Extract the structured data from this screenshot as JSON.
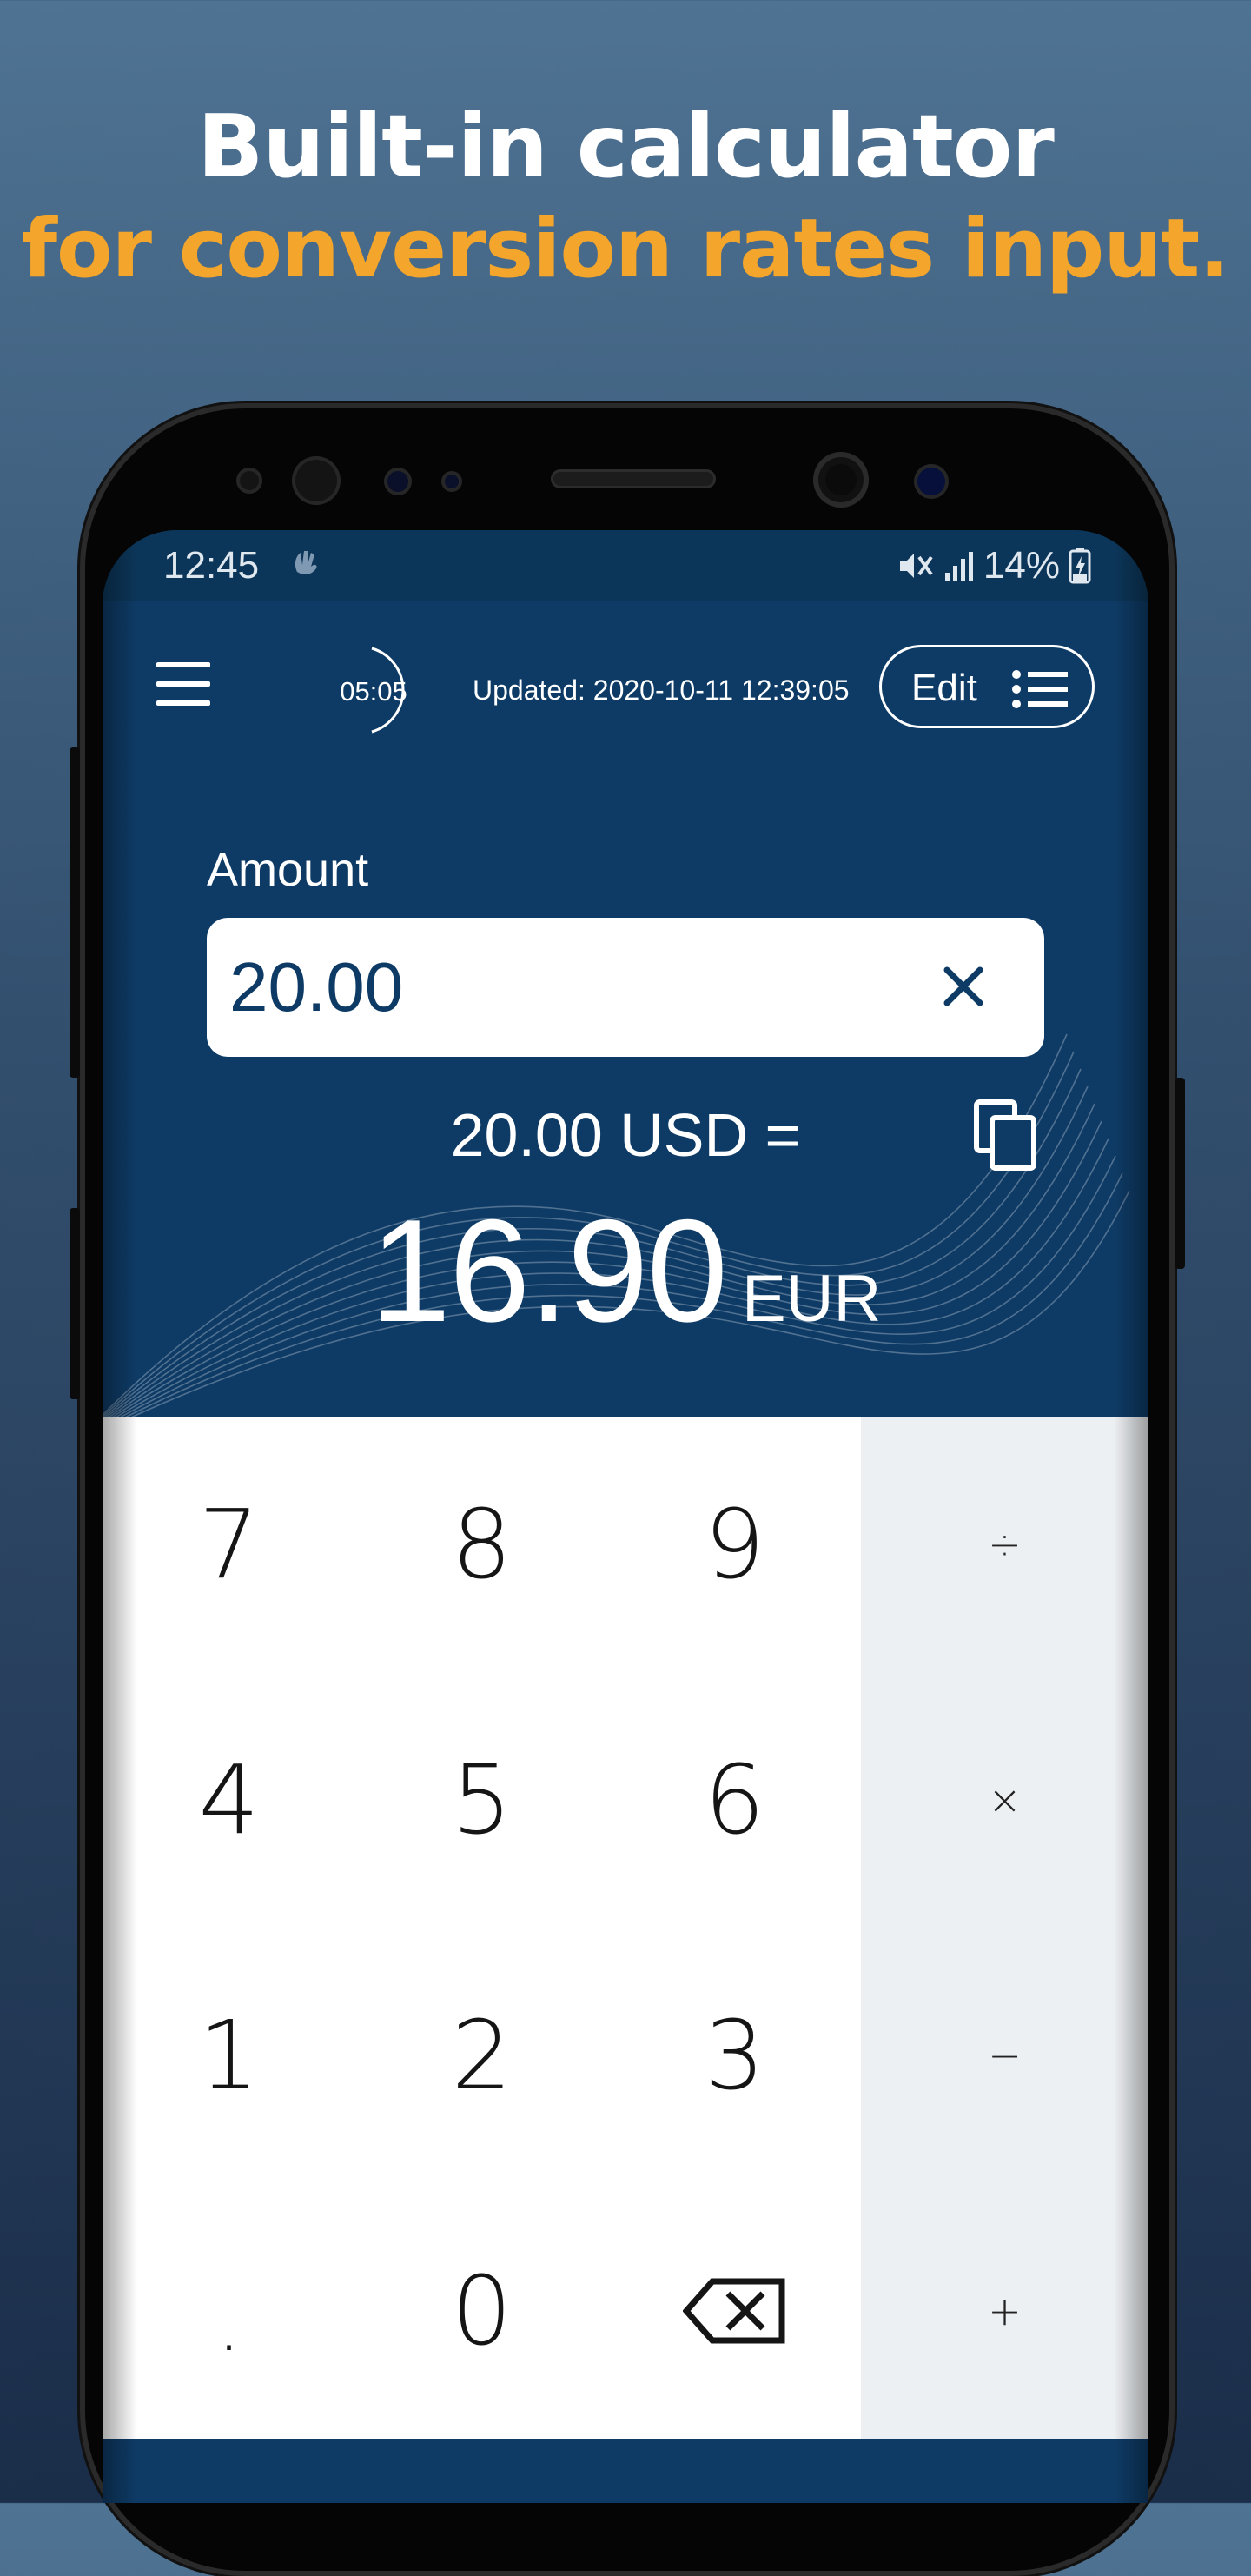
{
  "promo": {
    "headline": "Built-in calculator",
    "subheadline": "for conversion rates input.",
    "headline_color": "#ffffff",
    "subheadline_color": "#f4a52b"
  },
  "status_bar": {
    "time": "12:45",
    "battery": "14%",
    "icons": [
      "gesture-icon",
      "mute-icon",
      "signal-icon",
      "battery-charging-icon"
    ]
  },
  "header": {
    "timer": "05:05",
    "updated": "Updated: 2020-10-11 12:39:05",
    "edit_label": "Edit"
  },
  "amount": {
    "label": "Amount",
    "value": "20.00"
  },
  "conversion": {
    "line": "20.00 USD =",
    "result_value": "16.90",
    "result_currency": "EUR"
  },
  "keypad": {
    "keys": [
      "7",
      "8",
      "9",
      "÷",
      "4",
      "5",
      "6",
      "×",
      "1",
      "2",
      "3",
      "−",
      ".",
      "0",
      "⌫",
      "+"
    ]
  },
  "colors": {
    "app_primary": "#0e3b66",
    "operator_column": "#edf0f3"
  }
}
